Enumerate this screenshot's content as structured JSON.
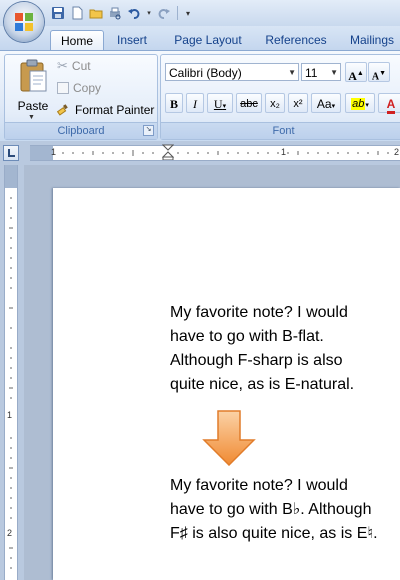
{
  "quick_access": {
    "icons": [
      "save-icon",
      "new-document-icon",
      "open-folder-icon",
      "print-preview-icon",
      "undo-icon",
      "redo-icon",
      "customize-toolbar-icon"
    ]
  },
  "tabs": [
    {
      "label": "Home",
      "active": true
    },
    {
      "label": "Insert",
      "active": false
    },
    {
      "label": "Page Layout",
      "active": false
    },
    {
      "label": "References",
      "active": false
    },
    {
      "label": "Mailings",
      "active": false
    }
  ],
  "clipboard": {
    "paste_label": "Paste",
    "cut_label": "Cut",
    "copy_label": "Copy",
    "format_painter_label": "Format Painter",
    "group_label": "Clipboard"
  },
  "font": {
    "font_name": "Calibri (Body)",
    "font_size": "11",
    "group_label": "Font",
    "bold": "B",
    "italic": "I",
    "underline": "U",
    "strikethrough": "abc",
    "subscript": "x₂",
    "superscript": "x²",
    "change_case": "Aa",
    "highlight": "ab",
    "font_color": "A"
  },
  "rulers": {
    "horizontal_numbers": [
      "1",
      "1",
      "2"
    ],
    "vertical_numbers": [
      "1",
      "2"
    ]
  },
  "document": {
    "paragraph_before": "My favorite note? I would\nhave to go with B-flat.\nAlthough F-sharp is also\nquite nice, as is E-natural.",
    "paragraph_after": "My favorite note? I would\nhave to go with B♭. Although\nF♯ is also quite nice, as is E♮."
  },
  "colors": {
    "accent": "#15428b",
    "arrow_fill": "#f4a352",
    "arrow_stroke": "#e17c2a"
  }
}
